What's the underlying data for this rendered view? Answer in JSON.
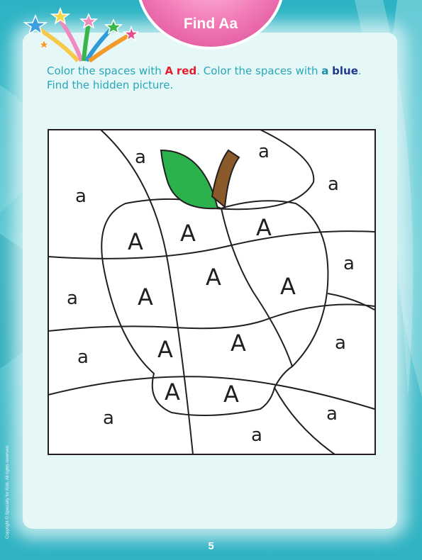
{
  "title": "Find Aa",
  "instructions": {
    "p1": "Color the spaces with ",
    "letter_upper": "A",
    "p2": " ",
    "color_red": "red",
    "p3": ". Color the spaces with ",
    "letter_lower": "a",
    "p4": " ",
    "color_blue": "blue",
    "p5": ".",
    "line2": "Find the hidden picture."
  },
  "puzzle": {
    "uppercase_letter": "A",
    "lowercase_letter": "a",
    "uppercase_count": 11,
    "lowercase_count": 12
  },
  "copyright": "Copyright © Specialty for Kids. All rights reserved.",
  "page_number": "5",
  "colors": {
    "background_teal": "#2bb3c4",
    "title_pink": "#f27bb7",
    "instruction_teal": "#27a7b8",
    "red": "#e41e2b",
    "blue": "#1f3a8a",
    "leaf_green": "#2bb24c",
    "stem_brown": "#8b5a2b"
  }
}
